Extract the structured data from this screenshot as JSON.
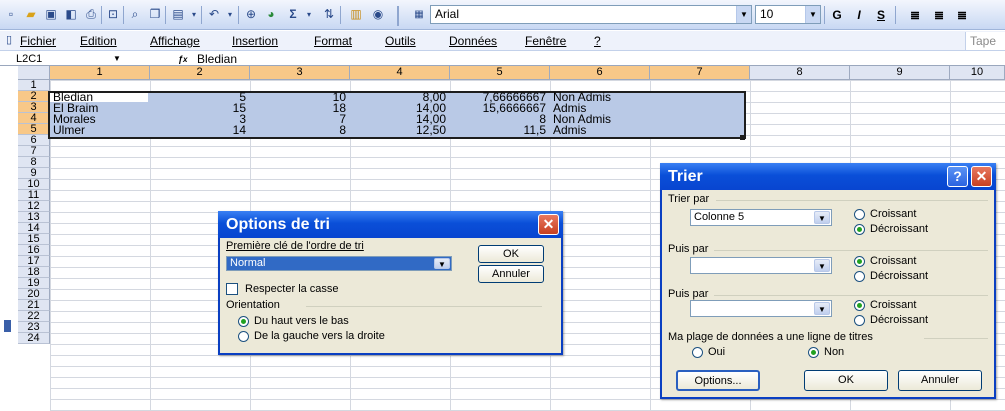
{
  "toolbar": {
    "font_name": "Arial",
    "font_size": "10",
    "bold": "G",
    "italic": "I",
    "underline": "S",
    "sum_symbol": "Σ"
  },
  "menu": {
    "items": [
      "Fichier",
      "Edition",
      "Affichage",
      "Insertion",
      "Format",
      "Outils",
      "Données",
      "Fenêtre",
      "?"
    ],
    "help_placeholder": "Tape"
  },
  "formula_bar": {
    "name_box": "L2C1",
    "fx": "fx",
    "value": "Bledian"
  },
  "sheet": {
    "columns": [
      "1",
      "2",
      "3",
      "4",
      "5",
      "6",
      "7",
      "8",
      "9",
      "10"
    ],
    "rows": [
      "1",
      "2",
      "3",
      "4",
      "5",
      "6",
      "7",
      "8",
      "9",
      "10",
      "11",
      "12",
      "13",
      "14",
      "15",
      "16",
      "17",
      "18",
      "19",
      "20",
      "21",
      "22",
      "23",
      "24"
    ],
    "data": [
      [
        "Bledian",
        "5",
        "10",
        "8,00",
        "7,66666667",
        "Non Admis"
      ],
      [
        "El Braim",
        "15",
        "18",
        "14,00",
        "15,6666667",
        "Admis"
      ],
      [
        "Morales",
        "3",
        "7",
        "14,00",
        "8",
        "Non Admis"
      ],
      [
        "Ulmer",
        "14",
        "8",
        "12,50",
        "11,5",
        "Admis"
      ]
    ]
  },
  "options_dialog": {
    "title": "Options de tri",
    "first_key_label": "Première clé de l'ordre de tri",
    "first_key_value": "Normal",
    "ok": "OK",
    "cancel": "Annuler",
    "case_label": "Respecter la casse",
    "orientation_label": "Orientation",
    "orient_top_bottom": "Du haut vers le bas",
    "orient_left_right": "De la gauche vers la droite"
  },
  "sort_dialog": {
    "title": "Trier",
    "sort_by_label": "Trier par",
    "sort_by_value": "Colonne 5",
    "then_by_label_1": "Puis par",
    "then_by_label_2": "Puis par",
    "ascending": "Croissant",
    "descending": "Décroissant",
    "header_row_label": "Ma plage de données a une ligne de titres",
    "yes": "Oui",
    "no": "Non",
    "options_btn": "Options...",
    "ok": "OK",
    "cancel": "Annuler"
  }
}
